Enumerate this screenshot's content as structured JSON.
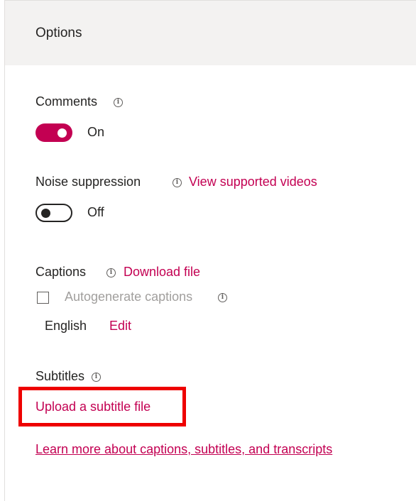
{
  "panel": {
    "title": "Options"
  },
  "comments": {
    "label": "Comments",
    "toggle_state": "On",
    "toggle_on": true
  },
  "noise": {
    "label": "Noise suppression",
    "link": "View supported videos",
    "toggle_state": "Off",
    "toggle_on": false
  },
  "captions": {
    "label": "Captions",
    "download_link": "Download file",
    "autogenerate_label": "Autogenerate captions",
    "autogenerate_checked": false,
    "language": "English",
    "edit_link": "Edit"
  },
  "subtitles": {
    "label": "Subtitles",
    "upload_link": "Upload a subtitle file"
  },
  "learn_more_link": "Learn more about captions, subtitles, and transcripts",
  "colors": {
    "accent": "#c30052",
    "highlight": "#ee0000",
    "header_bg": "#f3f2f1"
  },
  "icons": {
    "info": "info-icon"
  }
}
